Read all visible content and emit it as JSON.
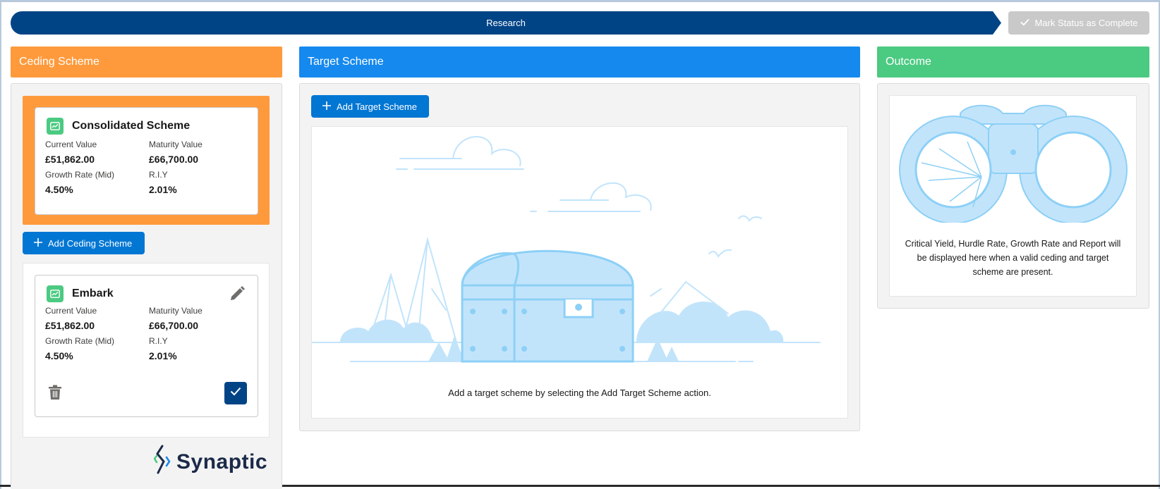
{
  "path": {
    "current_stage": "Research",
    "mark_complete_label": "Mark Status as Complete"
  },
  "columns": {
    "ceding": {
      "title": "Ceding Scheme"
    },
    "target": {
      "title": "Target Scheme"
    },
    "outcome": {
      "title": "Outcome"
    }
  },
  "ceding": {
    "consolidated": {
      "name": "Consolidated Scheme",
      "current_value_label": "Current Value",
      "current_value": "£51,862.00",
      "maturity_value_label": "Maturity Value",
      "maturity_value": "£66,700.00",
      "growth_rate_label": "Growth Rate (Mid)",
      "growth_rate": "4.50%",
      "riy_label": "R.I.Y",
      "riy": "2.01%"
    },
    "add_button_label": "Add Ceding Scheme",
    "schemes": [
      {
        "name": "Embark",
        "current_value_label": "Current Value",
        "current_value": "£51,862.00",
        "maturity_value_label": "Maturity Value",
        "maturity_value": "£66,700.00",
        "growth_rate_label": "Growth Rate (Mid)",
        "growth_rate": "4.50%",
        "riy_label": "R.I.Y",
        "riy": "2.01%",
        "selected": true
      }
    ]
  },
  "target": {
    "add_button_label": "Add Target Scheme",
    "empty_message": "Add a target scheme by selecting the Add Target Scheme action."
  },
  "outcome": {
    "empty_message": "Critical Yield, Hurdle Rate, Growth Rate and Report will be displayed here when a valid ceding and target scheme are present."
  },
  "branding": {
    "logo_text": "Synaptic"
  },
  "colors": {
    "path_blue": "#014486",
    "ceding_orange": "#ff9a3c",
    "target_blue": "#1589ee",
    "outcome_green": "#4bca81",
    "button_blue": "#0176d3",
    "illustration_blue": "#c2e4fb"
  }
}
